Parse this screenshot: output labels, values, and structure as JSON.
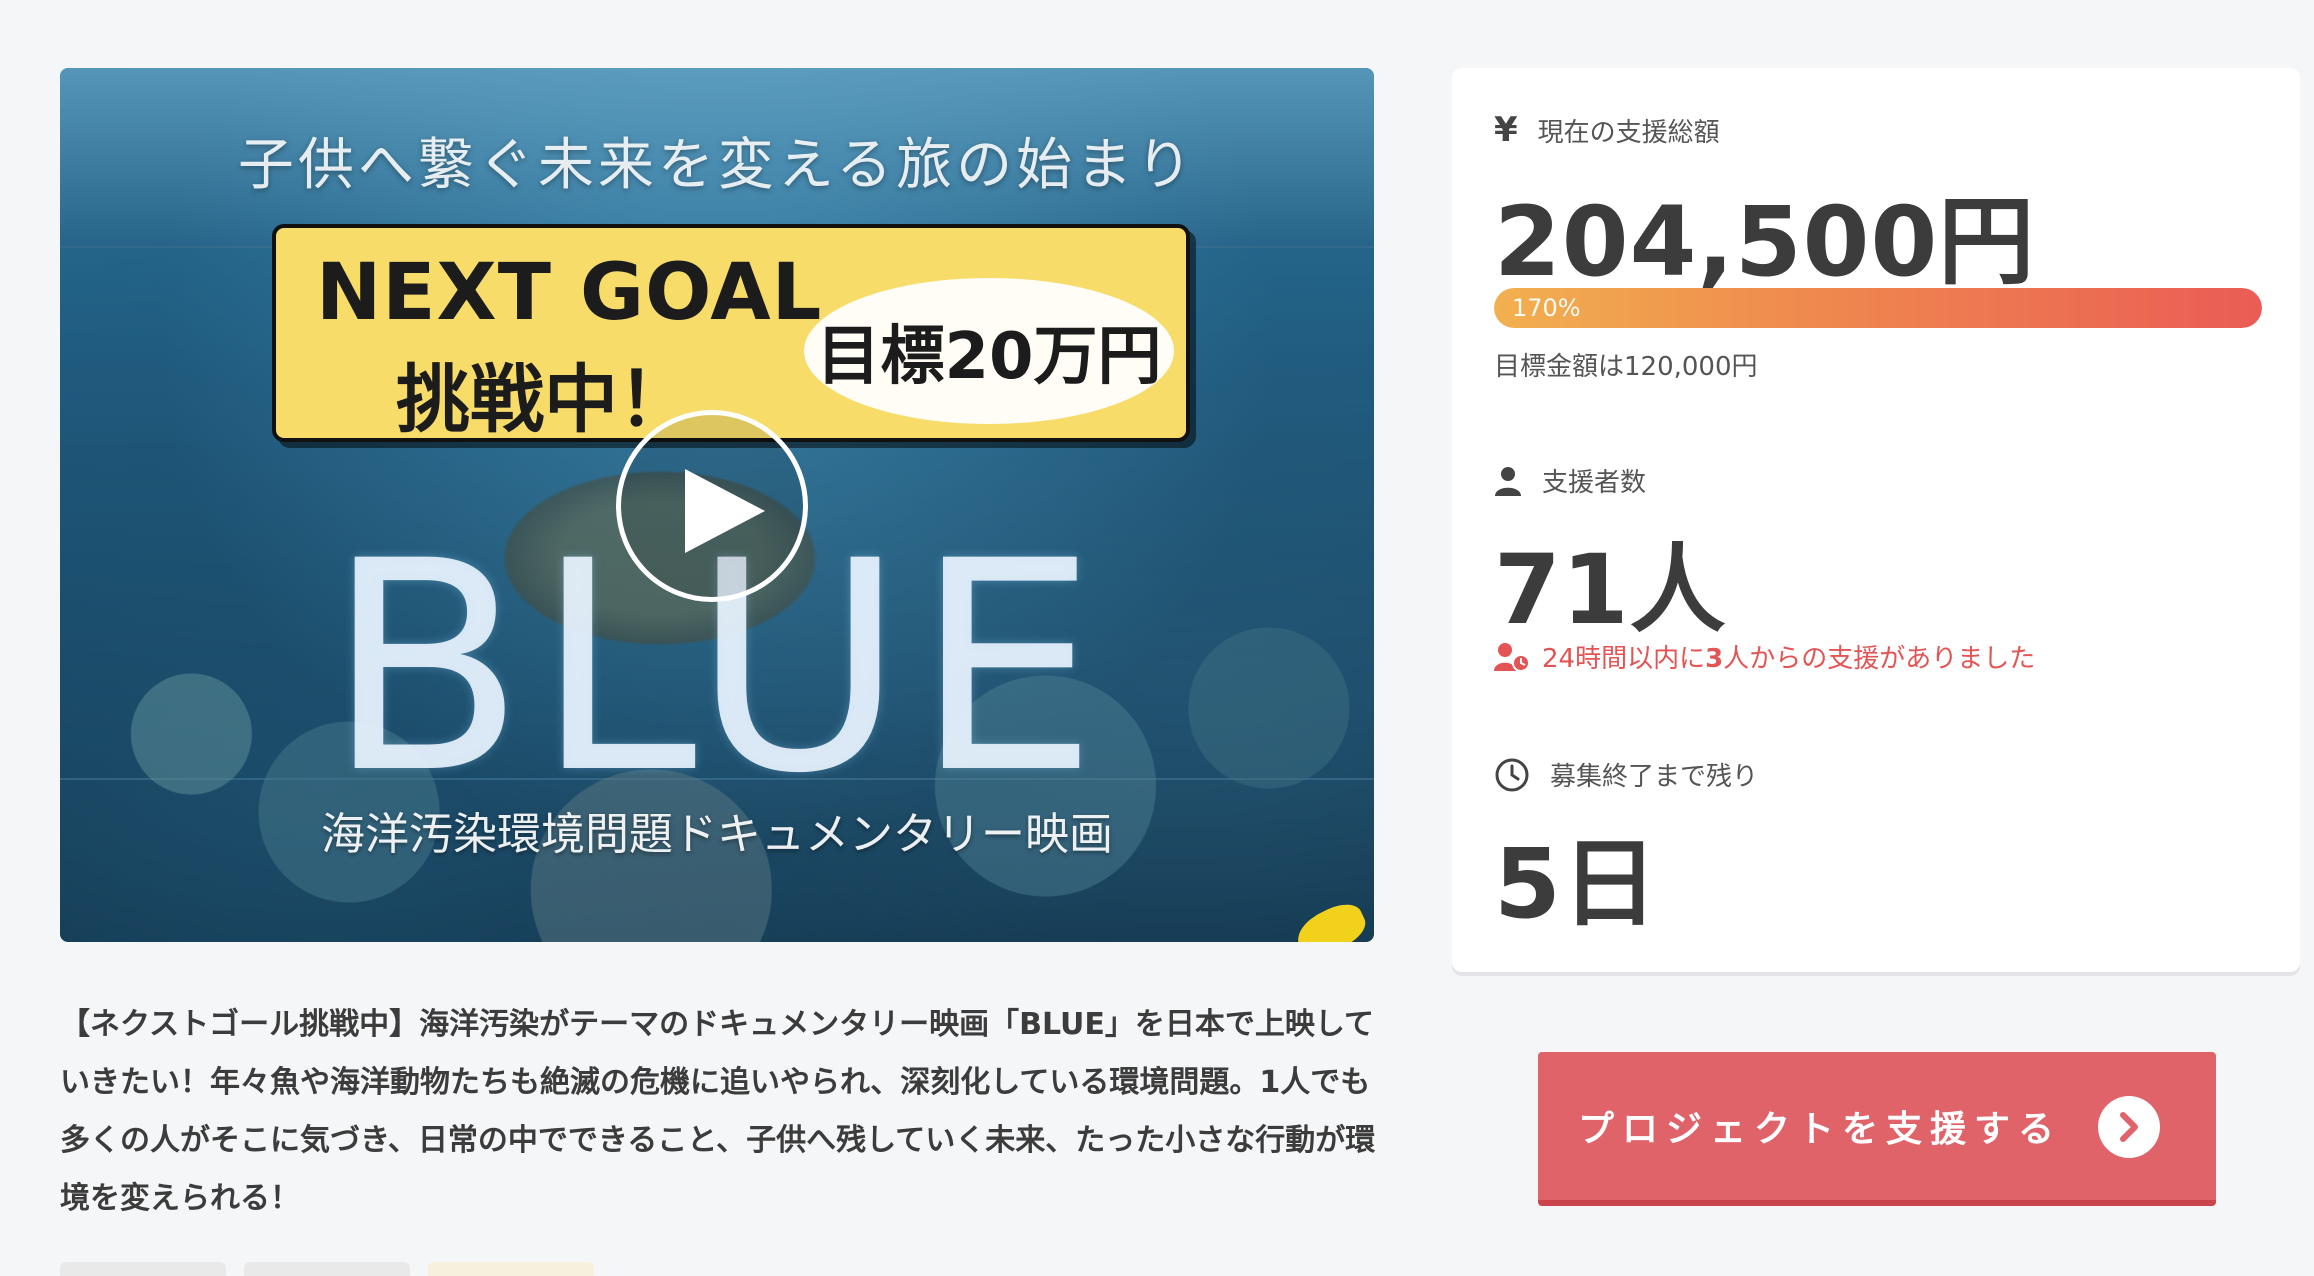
{
  "hero": {
    "headline": "子供へ繋ぐ未来を変える旅の始まり",
    "goal_en": "NEXT GOAL",
    "goal_jp": "挑戦中！",
    "goal_target": "目標20万円",
    "title": "BLUE",
    "subtitle": "海洋汚染環境問題ドキュメンタリー映画"
  },
  "description": "【ネクストゴール挑戦中】海洋汚染がテーマのドキュメンタリー映画「BLUE」を日本で上映していきたい！年々魚や海洋動物たちも絶滅の危機に追いやられ、深刻化している環境問題。1人でも多くの人がそこに気づき、日常の中でできること、子供へ残していく未来、たった小さな行動が環境を変えられる！",
  "stats": {
    "funding_label": "現在の支援総額",
    "funding_amount": "204,500円",
    "progress_text": "170%",
    "progress_value": 1.7,
    "goal_note": "目標金額は120,000円",
    "supporters_label": "支援者数",
    "supporters_count": "71人",
    "recent_prefix": "24時間以内に",
    "recent_count": "3",
    "recent_suffix": "人からの支援がありました",
    "remaining_label": "募集終了まで残り",
    "remaining_value": "5日"
  },
  "cta": {
    "label": "プロジェクトを支援する"
  },
  "icons": {
    "yen": "¥",
    "supporter": "user-icon",
    "clock": "clock-icon",
    "play": "play-icon",
    "arrow": "chevron-right-icon"
  },
  "colors": {
    "accent": "#e0636a",
    "alert_text": "#e35454",
    "progress_start": "#f2b04f",
    "progress_end": "#ea5c55"
  }
}
